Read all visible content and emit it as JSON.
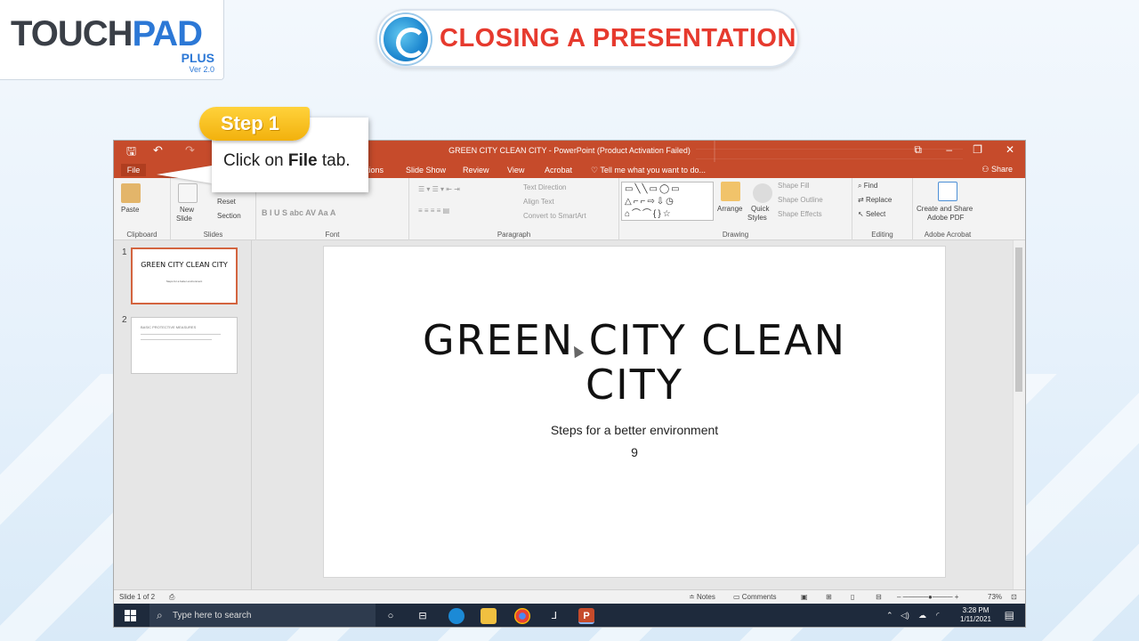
{
  "logo": {
    "brand_left": "TOUCH",
    "brand_right": "PAD",
    "edition": "PLUS",
    "version": "Ver 2.0"
  },
  "lesson": {
    "title": "CLOSING A PRESENTATION"
  },
  "callout": {
    "badge": "Step 1",
    "text_prefix": "Click on ",
    "text_bold": "File",
    "text_suffix": " tab."
  },
  "window": {
    "title": "GREEN CITY CLEAN CITY - PowerPoint (Product Activation Failed)",
    "controls": {
      "restore": "⧉",
      "minimize": "–",
      "maximize": "❐",
      "close": "✕"
    }
  },
  "tabs": [
    {
      "label": "File"
    },
    {
      "label": "tions"
    },
    {
      "label": "Slide Show"
    },
    {
      "label": "Review"
    },
    {
      "label": "View"
    },
    {
      "label": "Acrobat"
    }
  ],
  "tell_me": "Tell me what you want to do...",
  "share": "Share",
  "ribbon": {
    "clipboard": {
      "paste": "Paste",
      "label": "Clipboard"
    },
    "slides": {
      "new_slide": "New",
      "new_slide2": "Slide",
      "reset": "Reset",
      "section": "Section",
      "label": "Slides"
    },
    "font": {
      "label": "Font",
      "buttons": "B   I   U   S   abc  AV   Aa   A"
    },
    "paragraph": {
      "text_direction": "Text Direction",
      "align_text": "Align Text",
      "convert": "Convert to SmartArt",
      "label": "Paragraph"
    },
    "drawing": {
      "shapes_row1": "▭╲╲▭◯▭",
      "shapes_row2": "△⌐⌐⇨⇩◷",
      "shapes_row3": "⌂⌒⌒{}☆",
      "arrange": "Arrange",
      "quick": "Quick",
      "styles": "Styles",
      "shape_fill": "Shape Fill",
      "shape_outline": "Shape Outline",
      "shape_effects": "Shape Effects",
      "label": "Drawing"
    },
    "editing": {
      "find": "Find",
      "replace": "Replace",
      "select": "Select",
      "label": "Editing"
    },
    "acrobat": {
      "create1": "Create and Share",
      "create2": "Adobe PDF",
      "label": "Adobe Acrobat"
    }
  },
  "thumbnails": [
    {
      "num": "1",
      "title": "GREEN CITY CLEAN CITY",
      "sub": "Steps for a better environment"
    },
    {
      "num": "2",
      "title": "BASIC PROTECTIVE MEASURES"
    }
  ],
  "slide": {
    "title": "GREEN CITY CLEAN CITY",
    "subtitle": "Steps for a better environment",
    "number": "9"
  },
  "status": {
    "slide_of": "Slide 1 of 2",
    "notes": "Notes",
    "comments": "Comments",
    "zoom": "73%"
  },
  "taskbar": {
    "search_placeholder": "Type here to search",
    "time": "3:28 PM",
    "date": "1/11/2021"
  }
}
